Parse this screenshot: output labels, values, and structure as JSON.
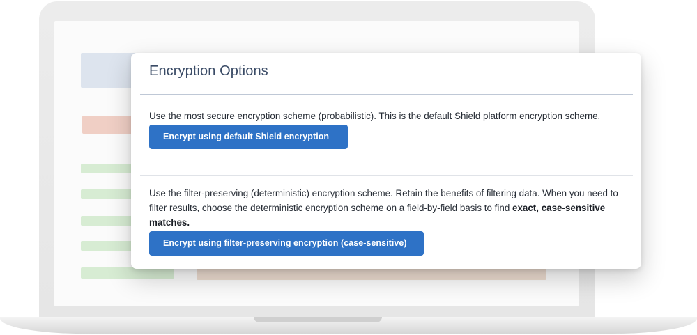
{
  "modal": {
    "title": "Encryption Options",
    "options": [
      {
        "description": "Use the most secure encryption scheme (probabilistic). This is the default Shield platform encryption scheme.",
        "button_label": "Encrypt using default Shield encryption"
      },
      {
        "description_prefix": "Use the filter-preserving (deterministic) encryption scheme. Retain the benefits of filtering data. When you need to filter results, choose the deterministic encryption scheme on a field-by-field basis to find ",
        "description_emphasis": "exact, case-sensitive matches.",
        "button_label": "Encrypt using filter-preserving encryption (case-sensitive)"
      }
    ]
  },
  "colors": {
    "title_text": "#3a4b66",
    "button_bg": "#2e72c6",
    "button_text": "#ffffff",
    "laptop_frame": "#e8e8e8"
  }
}
